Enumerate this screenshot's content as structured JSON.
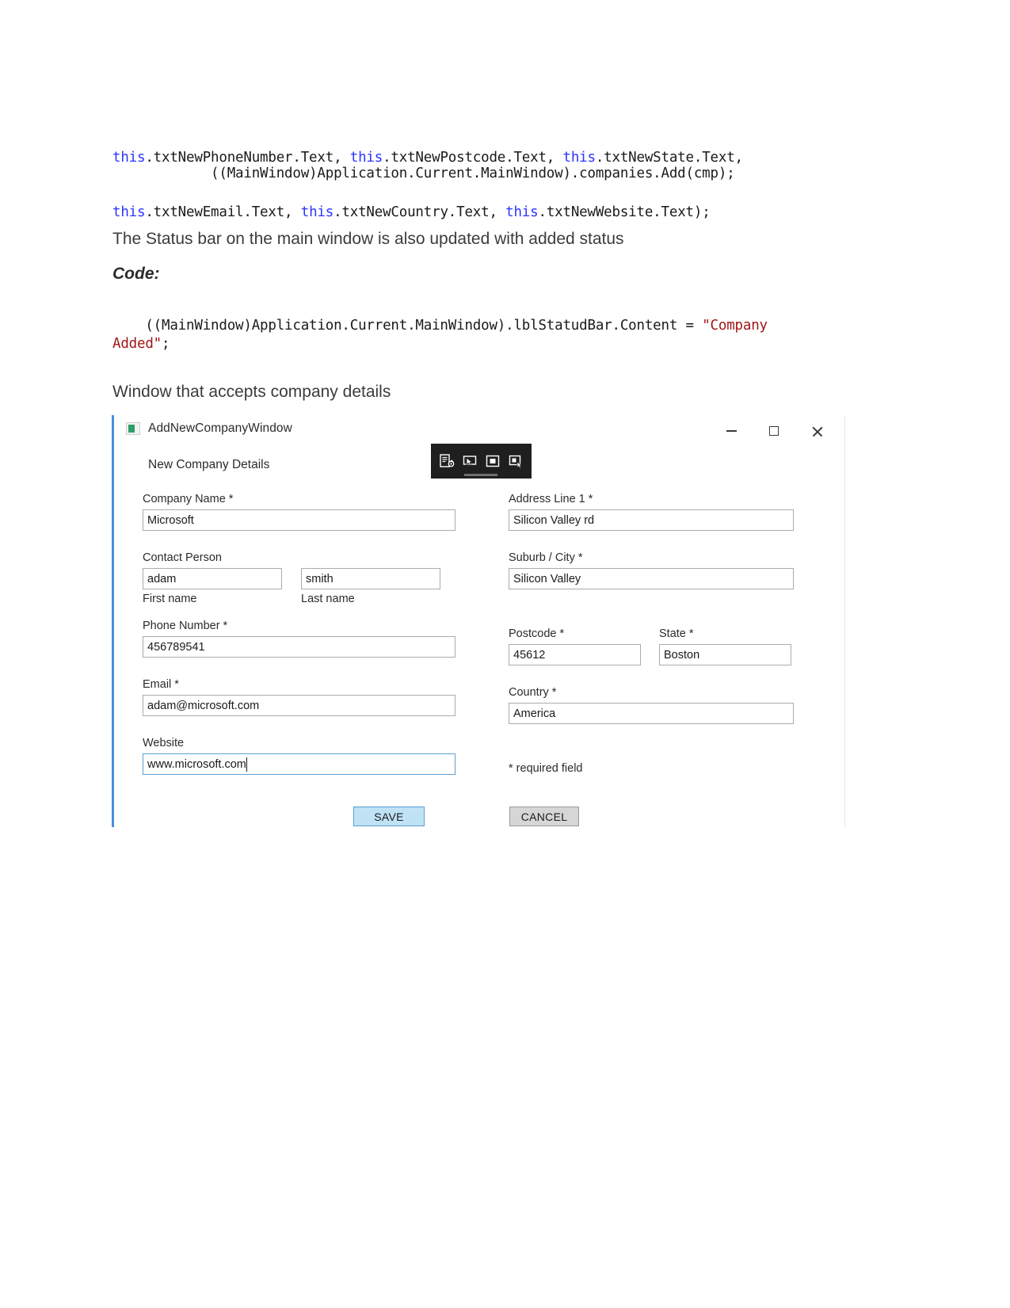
{
  "document": {
    "code_top": {
      "line1_parts": [
        {
          "t": "this",
          "k": "kw"
        },
        {
          "t": ".txtNewPhoneNumber.Text, ",
          "k": "n"
        },
        {
          "t": "this",
          "k": "kw"
        },
        {
          "t": ".txtNewPostcode.Text, ",
          "k": "n"
        },
        {
          "t": "this",
          "k": "kw"
        },
        {
          "t": ".txtNewState.Text,",
          "k": "n"
        }
      ],
      "line2_parts": [
        {
          "t": "this",
          "k": "kw"
        },
        {
          "t": ".txtNewEmail.Text, ",
          "k": "n"
        },
        {
          "t": "this",
          "k": "kw"
        },
        {
          "t": ".txtNewCountry.Text, ",
          "k": "n"
        },
        {
          "t": "this",
          "k": "kw"
        },
        {
          "t": ".txtNewWebsite.Text);",
          "k": "n"
        }
      ]
    },
    "code_add": "            ((MainWindow)Application.Current.MainWindow).companies.Add(cmp);",
    "paragraph_status": "The Status bar on the main window is also updated with added status",
    "label_code": "Code:",
    "code_status": {
      "parts": [
        {
          "t": "((MainWindow)Application.Current.MainWindow).lblStatudBar.Content = ",
          "k": "n"
        },
        {
          "t": "\"Company Added\"",
          "k": "str"
        },
        {
          "t": ";",
          "k": "n"
        }
      ]
    },
    "heading_window": "Window that accepts company details"
  },
  "app_window": {
    "title": "AddNewCompanyWindow",
    "form_title": "New Company Details",
    "window_controls": {
      "minimize": "minimize",
      "maximize": "maximize",
      "close": "close"
    },
    "debug_toolbar": {
      "icons": [
        "go-to-live-visual-tree-icon",
        "select-element-icon",
        "display-layout-adorners-icon",
        "track-focused-element-icon"
      ]
    },
    "fields_left": [
      {
        "label": "Company Name *",
        "value": "Microsoft",
        "name": "company-name"
      },
      {
        "label": "Contact Person",
        "name": "contact-person",
        "first": {
          "value": "adam",
          "sub": "First name",
          "name": "first-name"
        },
        "last": {
          "value": "smith",
          "sub": "Last name",
          "name": "last-name"
        }
      },
      {
        "label": "Phone Number *",
        "value": "456789541",
        "name": "phone-number"
      },
      {
        "label": "Email *",
        "value": "adam@microsoft.com",
        "name": "email"
      },
      {
        "label": "Website",
        "value": "www.microsoft.com",
        "name": "website",
        "focused": true
      }
    ],
    "fields_right": [
      {
        "label": "Address Line 1 *",
        "value": "Silicon Valley rd",
        "name": "address-line-1"
      },
      {
        "label": "Suburb / City *",
        "value": "Silicon Valley",
        "name": "suburb-city"
      },
      {
        "label": "Postcode *",
        "value": "45612",
        "name": "postcode",
        "state_label": "State *",
        "state_value": "Boston"
      },
      {
        "label": "Country *",
        "value": "America",
        "name": "country"
      }
    ],
    "required_note": "* required field",
    "buttons": {
      "save": "SAVE",
      "cancel": "CANCEL"
    },
    "colors": {
      "focus_border": "#5a9fd4",
      "save_fill": "#bfe2f5",
      "cancel_fill": "#d6d6d6",
      "left_accent": "#4a90d9",
      "toolbar_bg": "#1f1f1f"
    }
  }
}
